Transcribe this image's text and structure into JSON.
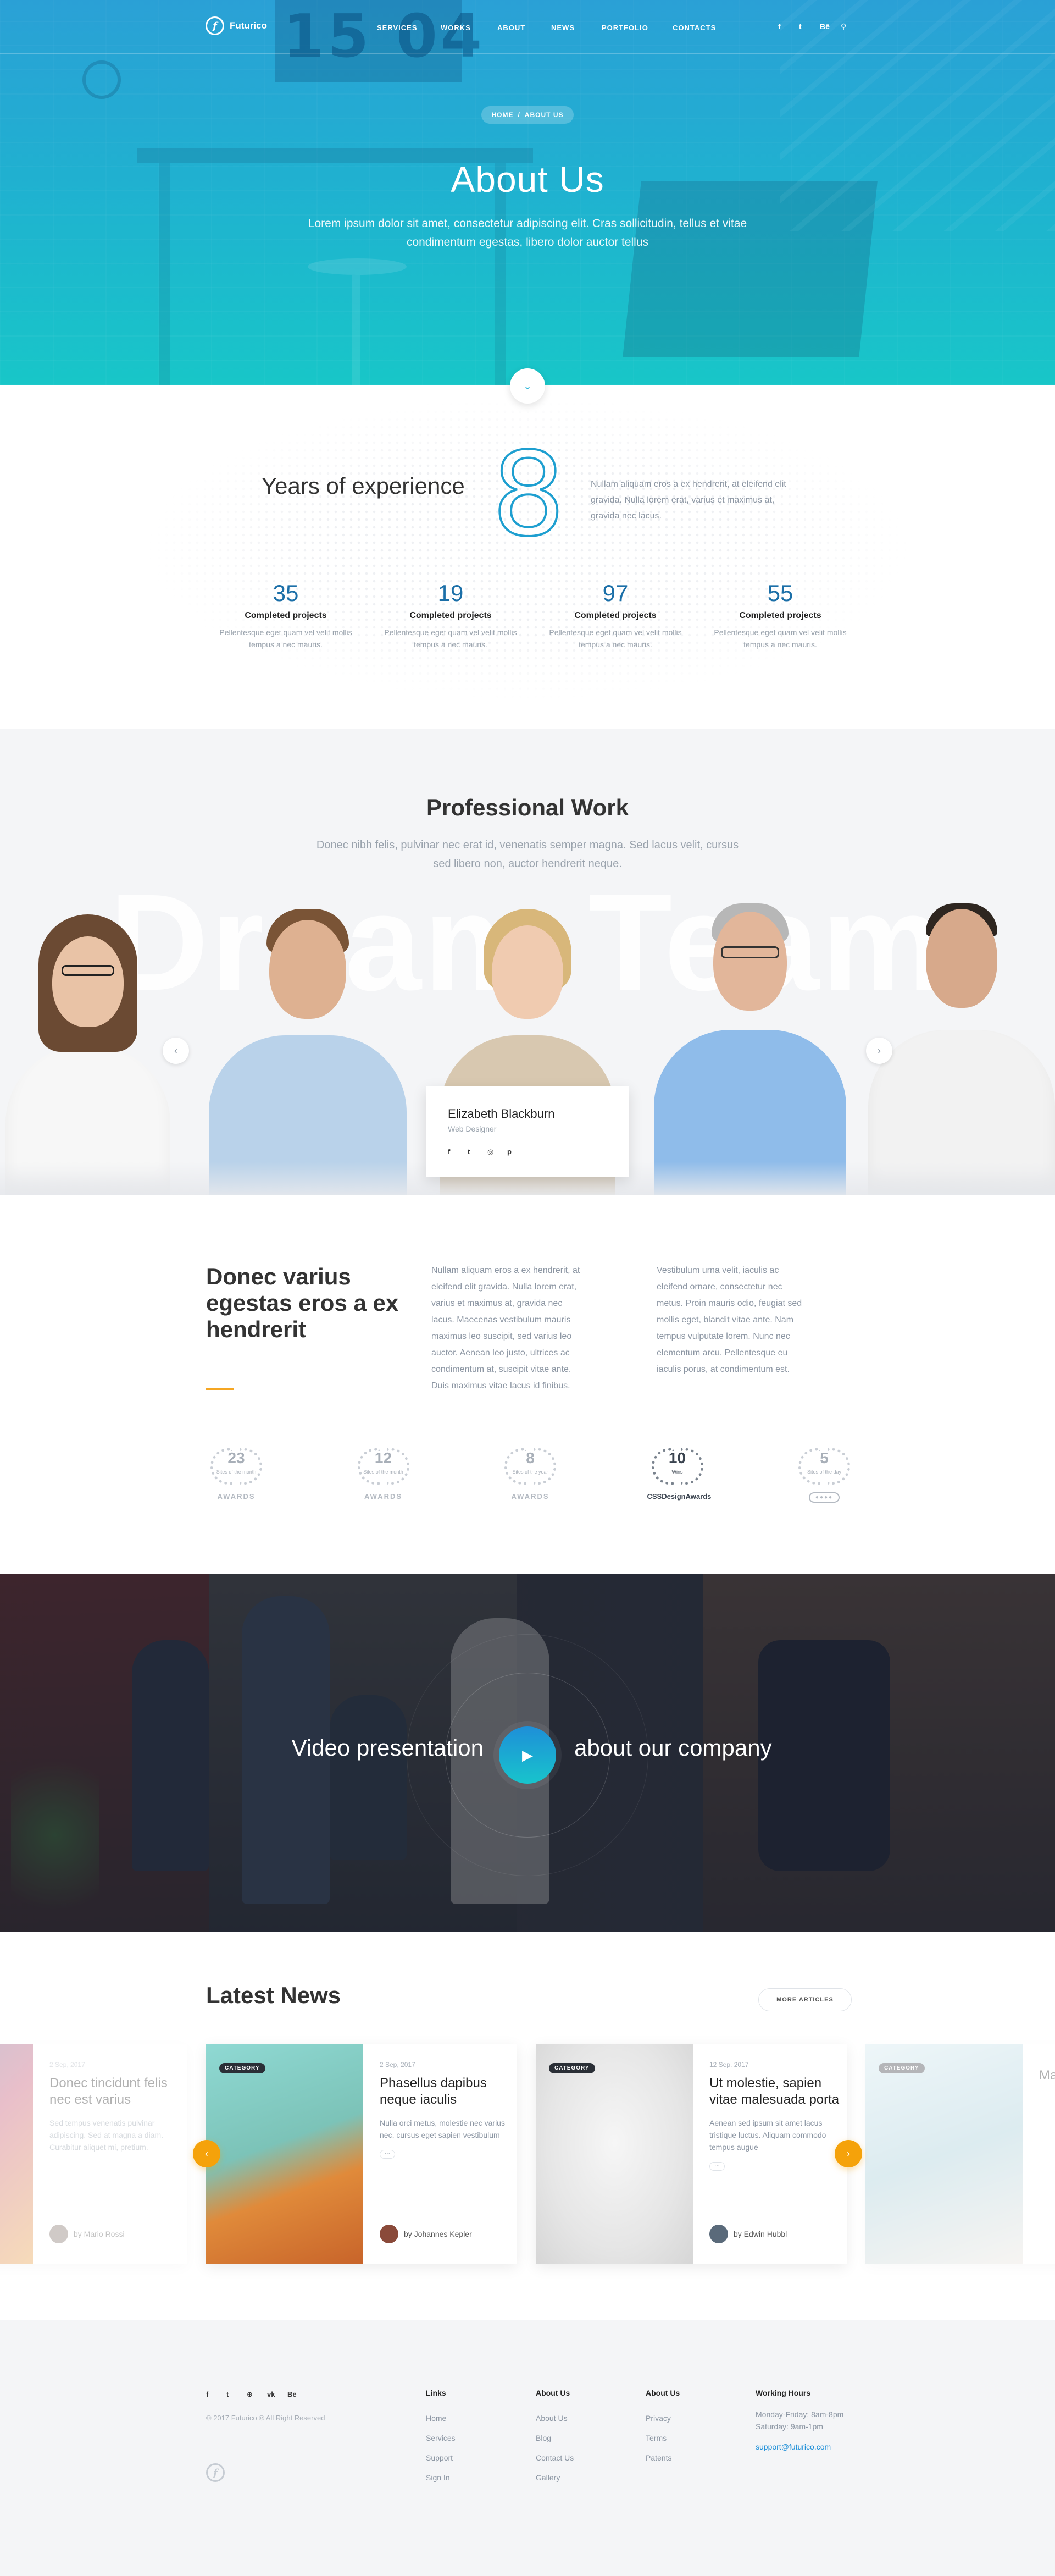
{
  "header": {
    "logo_mark": "f",
    "logo_text": "Futurico",
    "clock": "15 04",
    "nav": [
      "SERVICES",
      "WORKS",
      "ABOUT",
      "NEWS",
      "PORTFOLIO",
      "CONTACTS"
    ],
    "social": [
      {
        "icon": "facebook-icon",
        "glyph": "f"
      },
      {
        "icon": "twitter-icon",
        "glyph": "t"
      },
      {
        "icon": "behance-icon",
        "glyph": "Bē"
      },
      {
        "icon": "search-icon",
        "glyph": "⚲"
      }
    ]
  },
  "hero": {
    "breadcrumb_home": "HOME",
    "breadcrumb_sep": "/",
    "breadcrumb_current": "ABOUT US",
    "title": "About Us",
    "subtitle": "Lorem ipsum dolor sit amet, consectetur adipiscing elit. Cras sollicitudin, tellus et vitae condimentum egestas, libero dolor auctor tellus",
    "scroll_glyph": "⌄"
  },
  "experience": {
    "label": "Years of experience",
    "number": "8",
    "text": "Nullam aliquam eros a ex hendrerit, at eleifend elit gravida. Nulla lorem erat, varius et maximus at, gravida nec lacus.",
    "stats": [
      {
        "value": "35",
        "label": "Completed projects",
        "desc": "Pellentesque eget quam vel velit mollis tempus a nec mauris."
      },
      {
        "value": "19",
        "label": "Completed projects",
        "desc": "Pellentesque eget quam vel velit mollis tempus a nec mauris."
      },
      {
        "value": "97",
        "label": "Completed projects",
        "desc": "Pellentesque eget quam vel velit mollis tempus a nec mauris."
      },
      {
        "value": "55",
        "label": "Completed projects",
        "desc": "Pellentesque eget quam vel velit mollis tempus a nec mauris."
      }
    ]
  },
  "team": {
    "title": "Professional Work",
    "subtitle": "Donec nibh felis, pulvinar nec erat id, venenatis semper magna. Sed lacus velit, cursus sed libero non, auctor hendrerit neque.",
    "watermark": "Dream Team",
    "prev": "‹",
    "next": "›",
    "card": {
      "name": "Elizabeth Blackburn",
      "role": "Web Designer",
      "social": [
        "f",
        "t",
        "◎",
        "p"
      ]
    }
  },
  "awards": {
    "title": "Donec varius egestas eros a ex hendrerit",
    "col1": "Nullam aliquam eros a ex hendrerit, at eleifend elit gravida. Nulla lorem erat, varius et maximus at, gravida nec lacus. Maecenas vestibulum mauris maximus leo suscipit, sed varius leo auctor. Aenean leo justo, ultrices ac condimentum at, suscipit vitae ante. Duis maximus vitae lacus id finibus.",
    "col2": "Vestibulum urna velit, iaculis ac eleifend ornare, consectetur nec metus. Proin mauris odio, feugiat sed mollis eget, blandit vitae ante. Nam tempus vulputate lorem. Nunc nec elementum arcu. Pellentesque eu iaculis porus, at condimentum est.",
    "badges": [
      {
        "num": "23",
        "sub": "Sites of the month",
        "label": "AWARDS",
        "dark": false
      },
      {
        "num": "12",
        "sub": "Sites of the month",
        "label": "AWARDS",
        "dark": false
      },
      {
        "num": "8",
        "sub": "Sites of the year",
        "label": "AWARDS",
        "dark": false
      },
      {
        "num": "10",
        "sub": "Wins",
        "label": "CSSDesignAwards",
        "dark": true
      },
      {
        "num": "5",
        "sub": "Sites of the day",
        "label": "●●●●",
        "dark": false
      }
    ]
  },
  "video": {
    "left": "Video presentation",
    "right": "about our company",
    "play": "▶"
  },
  "news": {
    "title": "Latest News",
    "more": "MORE ARTICLES",
    "prev": "‹",
    "next": "›",
    "cards": [
      {
        "tag": "",
        "date": "2 Sep, 2017",
        "title": "Donec tincidunt felis nec est varius",
        "text": "Sed tempus venenatis pulvinar adipiscing. Sed at magna a diam. Curabitur aliquet mi, pretium.",
        "author": "by Mario Rossi"
      },
      {
        "tag": "CATEGORY",
        "date": "2 Sep, 2017",
        "title": "Phasellus dapibus neque iaculis",
        "text": "Nulla orci metus, molestie nec varius nec, cursus eget sapien vestibulum",
        "author": "by Johannes Kepler"
      },
      {
        "tag": "CATEGORY",
        "date": "12 Sep, 2017",
        "title": "Ut molestie, sapien vitae malesuada porta",
        "text": "Aenean sed ipsum sit amet lacus tristique luctus. Aliquam commodo tempus augue",
        "author": "by Edwin Hubbl"
      },
      {
        "tag": "CATEGORY",
        "date": "",
        "title": "Ma",
        "text": "",
        "author": ""
      }
    ]
  },
  "footer": {
    "social": [
      "f",
      "t",
      "⊕",
      "vk",
      "Bē"
    ],
    "copyright": "© 2017 Futurico ® All Right Reserved",
    "logo_mark": "f",
    "cols": [
      {
        "title": "Links",
        "items": [
          "Home",
          "Services",
          "Support",
          "Sign In"
        ]
      },
      {
        "title": "About Us",
        "items": [
          "About Us",
          "Blog",
          "Contact Us",
          "Gallery"
        ]
      },
      {
        "title": "About Us",
        "items": [
          "Privacy",
          "Terms",
          "Patents"
        ]
      }
    ],
    "hours": {
      "title": "Working Hours",
      "line1": "Monday-Friday: 8am-8pm",
      "line2": "Saturday: 9am-1pm",
      "email": "support@futurico.com"
    }
  },
  "colors": {
    "accent_blue": "#1e8fd8",
    "accent_teal": "#18c4cc",
    "accent_orange": "#f5a20a",
    "stat_blue": "#1b6fa8"
  }
}
